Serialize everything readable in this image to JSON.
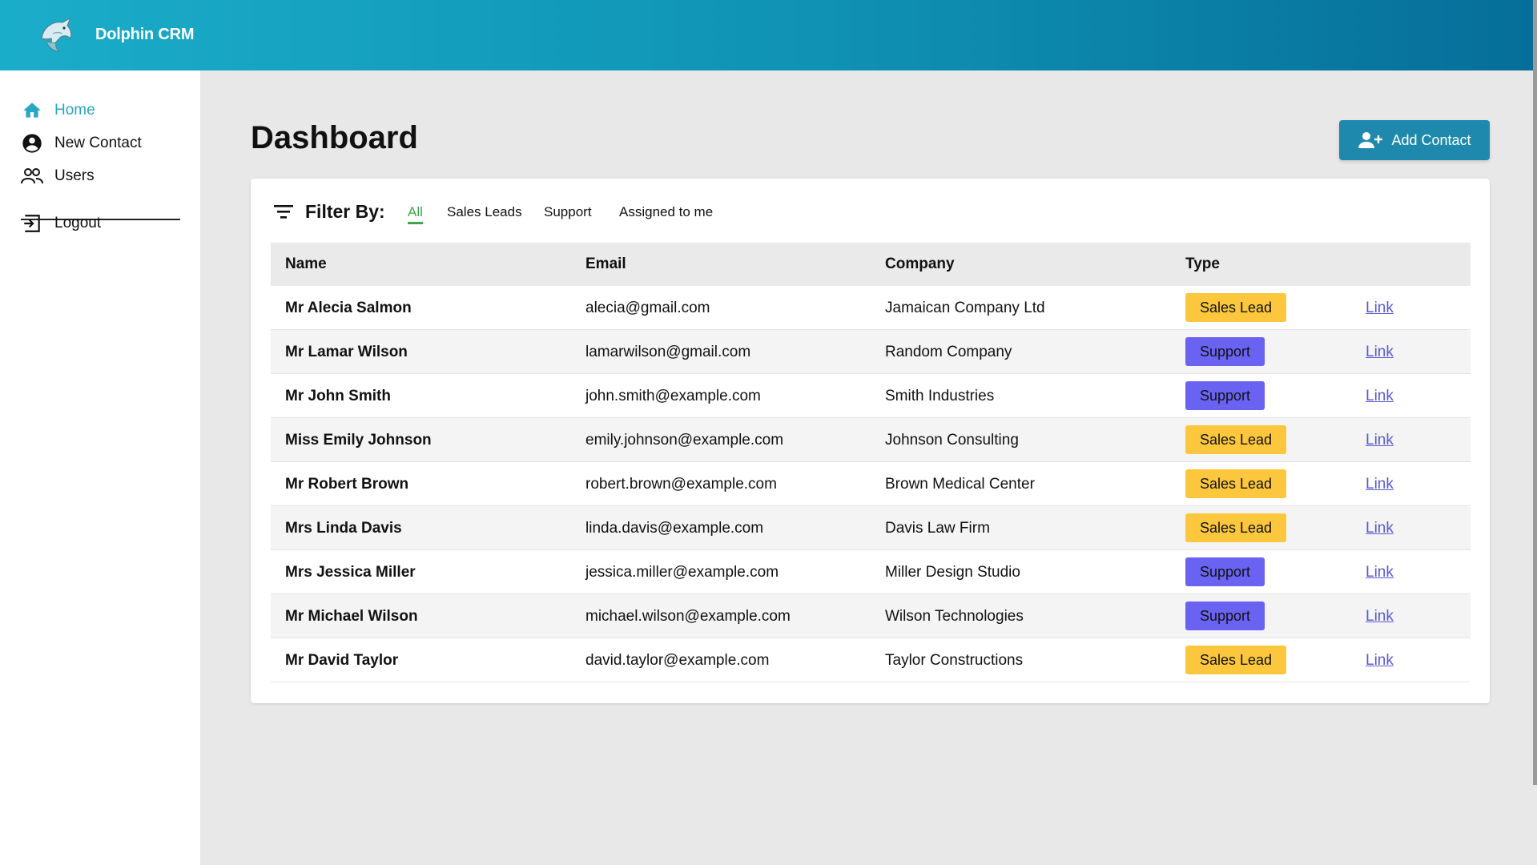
{
  "app": {
    "title": "Dolphin CRM"
  },
  "sidebar": {
    "items": [
      {
        "label": "Home",
        "icon": "home-icon",
        "active": true
      },
      {
        "label": "New Contact",
        "icon": "account-circle-icon",
        "active": false
      },
      {
        "label": "Users",
        "icon": "users-icon",
        "active": false
      },
      {
        "label": "Logout",
        "icon": "logout-icon",
        "active": false
      }
    ]
  },
  "main": {
    "title": "Dashboard",
    "add_button": {
      "label": "Add Contact",
      "icon": "add-user-icon"
    },
    "filter": {
      "label": "Filter By:",
      "options": [
        "All",
        "Sales Leads",
        "Support",
        "Assigned to me"
      ],
      "selected": "All"
    },
    "table": {
      "headers": [
        "Name",
        "Email",
        "Company",
        "Type"
      ],
      "rows": [
        {
          "name": "Mr Alecia Salmon",
          "email": "alecia@gmail.com",
          "company": "Jamaican Company Ltd",
          "type": "Sales Lead",
          "link": "Link"
        },
        {
          "name": "Mr Lamar Wilson",
          "email": "lamarwilson@gmail.com",
          "company": "Random Company",
          "type": "Support",
          "link": "Link"
        },
        {
          "name": "Mr John Smith",
          "email": "john.smith@example.com",
          "company": "Smith Industries",
          "type": "Support",
          "link": "Link"
        },
        {
          "name": "Miss Emily Johnson",
          "email": "emily.johnson@example.com",
          "company": "Johnson Consulting",
          "type": "Sales Lead",
          "link": "Link"
        },
        {
          "name": "Mr Robert Brown",
          "email": "robert.brown@example.com",
          "company": "Brown Medical Center",
          "type": "Sales Lead",
          "link": "Link"
        },
        {
          "name": "Mrs Linda Davis",
          "email": "linda.davis@example.com",
          "company": "Davis Law Firm",
          "type": "Sales Lead",
          "link": "Link"
        },
        {
          "name": "Mrs Jessica Miller",
          "email": "jessica.miller@example.com",
          "company": "Miller Design Studio",
          "type": "Support",
          "link": "Link"
        },
        {
          "name": "Mr Michael Wilson",
          "email": "michael.wilson@example.com",
          "company": "Wilson Technologies",
          "type": "Support",
          "link": "Link"
        },
        {
          "name": "Mr David Taylor",
          "email": "david.taylor@example.com",
          "company": "Taylor Constructions",
          "type": "Sales Lead",
          "link": "Link"
        }
      ]
    }
  },
  "colors": {
    "header_start": "#1aadc9",
    "header_end": "#066e9a",
    "accent": "#2aa6c3",
    "sales_lead_badge": "#fcc73c",
    "support_badge": "#6a63f2",
    "filter_active": "#3aa84a",
    "link": "#5b5bd6"
  }
}
